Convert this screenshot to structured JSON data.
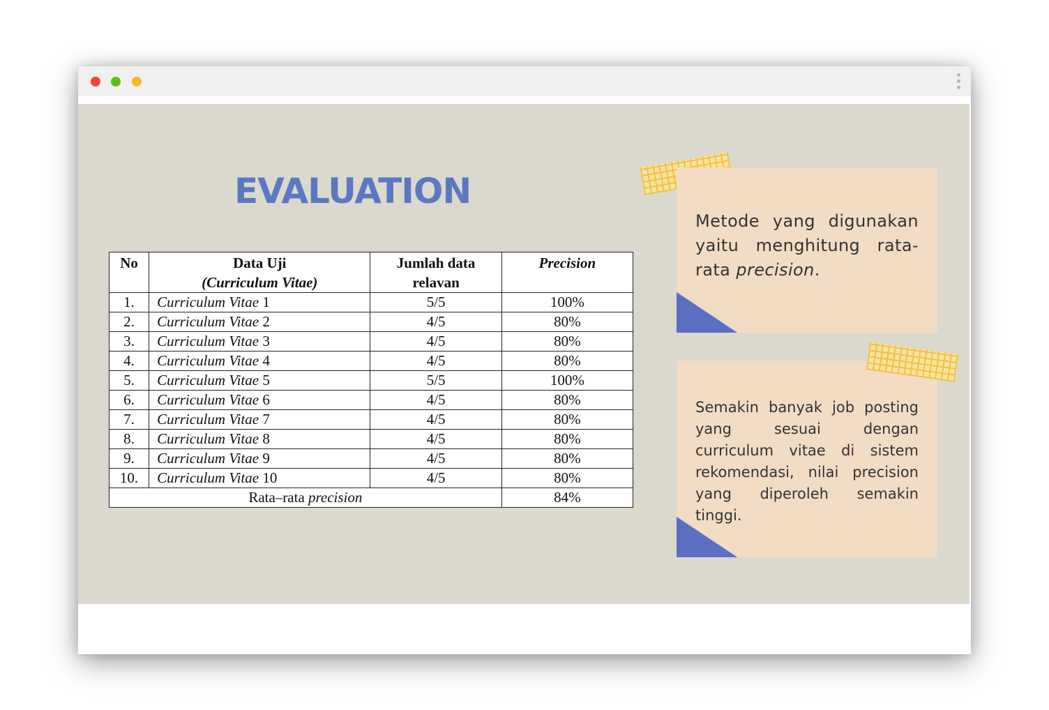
{
  "window": {
    "controls": [
      "close",
      "minimize",
      "maximize"
    ],
    "menu_icon": "more-vertical-icon"
  },
  "slide": {
    "title": "EVALUATION",
    "table": {
      "headers": {
        "no": "No",
        "data_uji": "Data Uji",
        "data_uji_sub": "(Curriculum Vitae)",
        "jumlah_line1": "Jumlah data",
        "jumlah_line2": "relavan",
        "precision": "Precision"
      },
      "rows": [
        {
          "no": "1.",
          "prefix": "Curriculum Vitae",
          "num": "1",
          "relevan": "5/5",
          "precision": "100%"
        },
        {
          "no": "2.",
          "prefix": "Curriculum Vitae",
          "num": "2",
          "relevan": "4/5",
          "precision": "80%"
        },
        {
          "no": "3.",
          "prefix": "Curriculum Vitae",
          "num": "3",
          "relevan": "4/5",
          "precision": "80%"
        },
        {
          "no": "4.",
          "prefix": "Curriculum Vitae",
          "num": "4",
          "relevan": "4/5",
          "precision": "80%"
        },
        {
          "no": "5.",
          "prefix": "Curriculum Vitae",
          "num": "5",
          "relevan": "5/5",
          "precision": "100%"
        },
        {
          "no": "6.",
          "prefix": "Curriculum Vitae",
          "num": "6",
          "relevan": "4/5",
          "precision": "80%"
        },
        {
          "no": "7.",
          "prefix": "Curriculum Vitae",
          "num": "7",
          "relevan": "4/5",
          "precision": "80%"
        },
        {
          "no": "8.",
          "prefix": "Curriculum Vitae",
          "num": "8",
          "relevan": "4/5",
          "precision": "80%"
        },
        {
          "no": "9.",
          "prefix": "Curriculum Vitae",
          "num": "9",
          "relevan": "4/5",
          "precision": "80%"
        },
        {
          "no": "10.",
          "prefix": "Curriculum Vitae",
          "num": "10",
          "relevan": "4/5",
          "precision": "80%"
        }
      ],
      "footer": {
        "label": "Rata–rata",
        "label_italic": "precision",
        "value": "84%"
      }
    },
    "note1": {
      "text": "Metode yang digunakan yaitu menghitung rata-rata",
      "text_italic": "precision",
      "text_end": "."
    },
    "note2": {
      "text": "Semakin banyak job posting yang sesuai dengan curriculum vitae di sistem rekomendasi, nilai precision yang diperoleh semakin tinggi."
    }
  },
  "colors": {
    "slide_bg": "#dbd8ce",
    "title": "#5b78c2",
    "note_bg": "#f2dcc4",
    "note_fold": "#5b6fc2",
    "tape": "#f5bf3a"
  }
}
